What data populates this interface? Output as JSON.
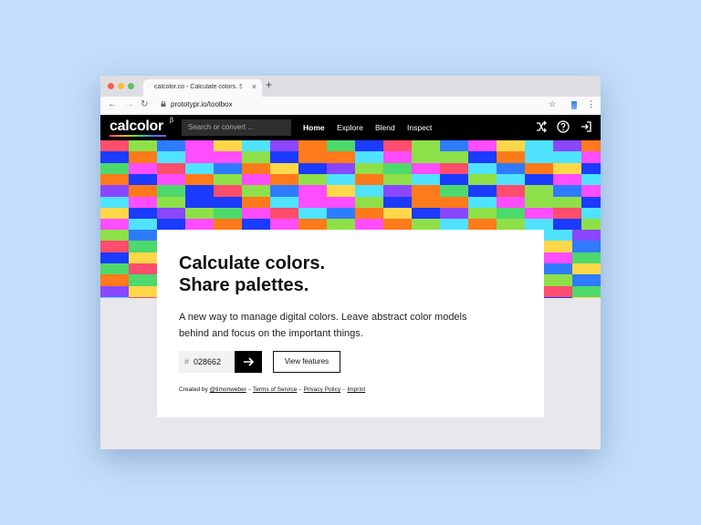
{
  "browser": {
    "tab_title": "calcolor.co - Calculate colors. Sh",
    "tab_close": "×",
    "new_tab": "+",
    "back": "←",
    "forward": "→",
    "reload": "↻",
    "url": "prototypr.io/toolbox",
    "star": "☆",
    "menu": "⋮",
    "traffic_lights": [
      "#f25d57",
      "#f7bd3b",
      "#59c35a"
    ]
  },
  "app": {
    "logo": "calcolor",
    "logo_beta": "β",
    "search_placeholder": "Search or convert ...",
    "nav": [
      "Home",
      "Explore",
      "Blend",
      "Inspect"
    ],
    "icons": [
      "shuffle-icon",
      "help-icon",
      "login-icon"
    ]
  },
  "hero": {
    "headline_line1": "Calculate colors.",
    "headline_line2": "Share palettes.",
    "subtext": "A new way to manage digital colors. Leave abstract color models behind and focus on the important things.",
    "hex_prefix": "#",
    "hex_value": "028662",
    "go_icon": "arrow-right-icon",
    "features_label": "View features"
  },
  "footer": {
    "created_by": "Created by",
    "author": "@timonweber",
    "dash": "–",
    "terms": "Terms of Service",
    "privacy": "Privacy Policy",
    "imprint": "Imprint"
  },
  "palette": [
    "#ff4d6d",
    "#ff7a1a",
    "#ffd84a",
    "#8ee048",
    "#4dd96b",
    "#4fe3ff",
    "#2f7bff",
    "#1b3bff",
    "#8a47ff",
    "#ff4dff"
  ]
}
